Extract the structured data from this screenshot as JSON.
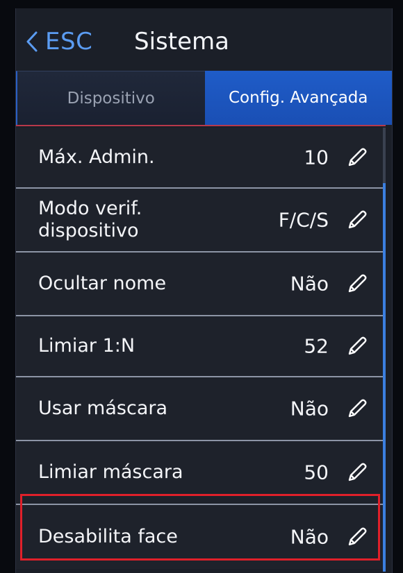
{
  "header": {
    "back_label": "ESC",
    "title": "Sistema"
  },
  "tabs": [
    {
      "label": "Dispositivo",
      "active": false
    },
    {
      "label": "Config. Avançada",
      "active": true
    }
  ],
  "settings": [
    {
      "label": "Máx. Admin.",
      "value": "10"
    },
    {
      "label": "Modo verif.\ndispositivo",
      "value": "F/C/S"
    },
    {
      "label": "Ocultar nome",
      "value": "Não"
    },
    {
      "label": "Limiar 1:N",
      "value": "52"
    },
    {
      "label": "Usar máscara",
      "value": "Não"
    },
    {
      "label": "Limiar máscara",
      "value": "50"
    },
    {
      "label": "Desabilita face",
      "value": "Não",
      "highlighted": true
    }
  ],
  "colors": {
    "accent": "#5b9cf2",
    "active_tab": "#1f5cc8",
    "highlight": "#e0202a"
  },
  "icons": {
    "back": "chevron-left-icon",
    "edit": "pencil-icon"
  }
}
